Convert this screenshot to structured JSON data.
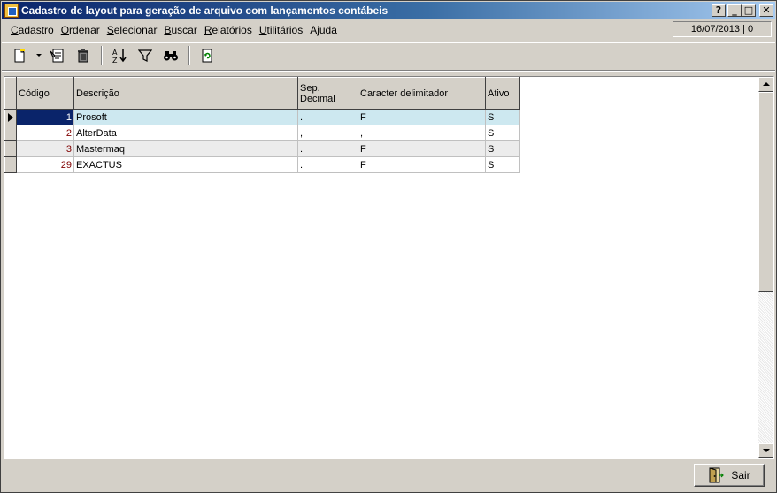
{
  "window": {
    "title": "Cadastro de layout para geração de arquivo com lançamentos contábeis",
    "buttons": {
      "help": "?",
      "minimize": "_",
      "maximize": "□",
      "close": "✕"
    }
  },
  "menu": {
    "items": [
      {
        "label": "Cadastro",
        "underline": "C"
      },
      {
        "label": "Ordenar",
        "underline": "O"
      },
      {
        "label": "Selecionar",
        "underline": "S"
      },
      {
        "label": "Buscar",
        "underline": "B"
      },
      {
        "label": "Relatórios",
        "underline": "R"
      },
      {
        "label": "Utilitários",
        "underline": "U"
      },
      {
        "label": "Ajuda",
        "underline": ""
      }
    ],
    "date_status": "16/07/2013 | 0"
  },
  "toolbar": {
    "icons": [
      "new-record-icon",
      "dropdown-arrow-icon",
      "edit-record-icon",
      "delete-trash-icon",
      "sort-az-icon",
      "filter-funnel-icon",
      "find-binoculars-icon",
      "refresh-icon"
    ]
  },
  "grid": {
    "columns": [
      "Código",
      "Descrição",
      "Sep. Decimal",
      "Caracter delimitador",
      "Ativo"
    ],
    "rows": [
      {
        "codigo": "1",
        "descricao": "Prosoft",
        "sep_decimal": ".",
        "delimitador": "F",
        "ativo": "S"
      },
      {
        "codigo": "2",
        "descricao": "AlterData",
        "sep_decimal": ",",
        "delimitador": ",",
        "ativo": "S"
      },
      {
        "codigo": "3",
        "descricao": "Mastermaq",
        "sep_decimal": ".",
        "delimitador": "F",
        "ativo": "S"
      },
      {
        "codigo": "29",
        "descricao": "EXACTUS",
        "sep_decimal": ".",
        "delimitador": "F",
        "ativo": "S"
      }
    ]
  },
  "footer": {
    "exit_label": "Sair",
    "exit_icon": "door-exit-icon"
  },
  "colors": {
    "title_gradient_start": "#0a246a",
    "title_gradient_end": "#a6caf0",
    "selected_cell": "#0a246a",
    "selected_row": "#cde8f0",
    "code_text": "#800000"
  }
}
